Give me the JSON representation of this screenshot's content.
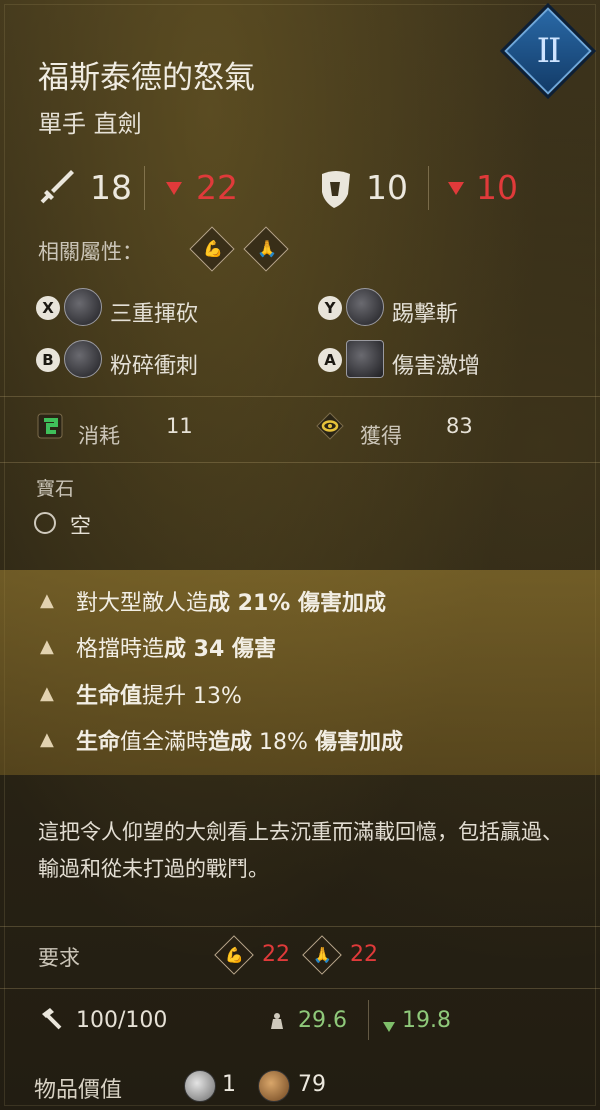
{
  "tier": "II",
  "item": {
    "name": "福斯泰德的怒氣",
    "type": "單手 直劍"
  },
  "stats": {
    "attack": "18",
    "attack_penalty": "22",
    "defense": "10",
    "defense_penalty": "10"
  },
  "affinity": {
    "label": "相關屬性："
  },
  "skills": [
    {
      "button": "X",
      "name": "三重揮砍"
    },
    {
      "button": "Y",
      "name": "踢擊斬"
    },
    {
      "button": "B",
      "name": "粉碎衝刺"
    },
    {
      "button": "A",
      "name": "傷害激增"
    }
  ],
  "resources": {
    "consume_label": "消耗",
    "consume_value": "11",
    "gain_label": "獲得",
    "gain_value": "83"
  },
  "gem": {
    "label": "寶石",
    "slot": "空"
  },
  "perks": [
    {
      "pre": "對大型敵人造",
      "bold": "成 21% 傷害加成",
      "post": ""
    },
    {
      "pre": "格擋時造",
      "bold": "成 34 傷害",
      "post": ""
    },
    {
      "pre": "",
      "bold": "生命值",
      "post": "提升 13%"
    },
    {
      "pre": "",
      "bold": "生命",
      "post2": "值全滿時",
      "bold2": "造成",
      "post": " 18% ",
      "bold3": "傷害加成"
    }
  ],
  "description": "這把令人仰望的大劍看上去沉重而滿載回憶，包括贏過、輸過和從未打過的戰鬥。",
  "requirements": {
    "label": "要求",
    "str": "22",
    "fai": "22"
  },
  "durability": {
    "value": "100/100",
    "weight": "29.6",
    "weight_delta": "19.8"
  },
  "value": {
    "label": "物品價值",
    "silver": "1",
    "bronze": "79"
  },
  "colors": {
    "penalty": "#e03a3a",
    "positive": "#8fc97a",
    "tier_blue": "#2a6aa8"
  }
}
